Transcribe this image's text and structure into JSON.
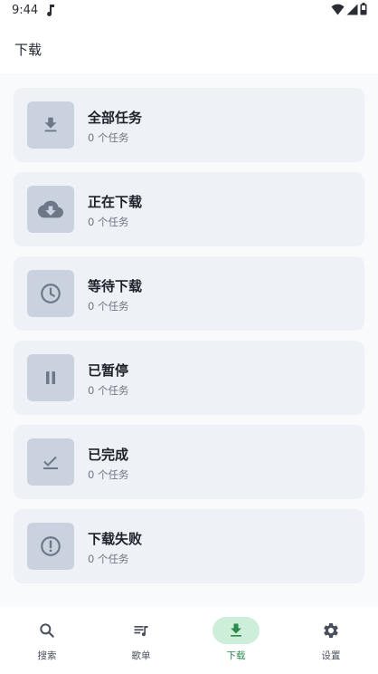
{
  "status_bar": {
    "time": "9:44"
  },
  "app_bar": {
    "title": "下载"
  },
  "categories": [
    {
      "title": "全部任务",
      "count_text": "0 个任务",
      "icon": "download-icon"
    },
    {
      "title": "正在下载",
      "count_text": "0 个任务",
      "icon": "cloud-download-icon"
    },
    {
      "title": "等待下载",
      "count_text": "0 个任务",
      "icon": "clock-icon"
    },
    {
      "title": "已暂停",
      "count_text": "0 个任务",
      "icon": "pause-icon"
    },
    {
      "title": "已完成",
      "count_text": "0 个任务",
      "icon": "done-icon"
    },
    {
      "title": "下载失败",
      "count_text": "0 个任务",
      "icon": "error-icon"
    }
  ],
  "bottom_nav": {
    "items": [
      {
        "label": "搜索",
        "icon": "search-icon",
        "active": false
      },
      {
        "label": "歌单",
        "icon": "playlist-icon",
        "active": false
      },
      {
        "label": "下载",
        "icon": "download-icon",
        "active": true
      },
      {
        "label": "设置",
        "icon": "settings-icon",
        "active": false
      }
    ]
  },
  "colors": {
    "accent": "#2c8a4f",
    "accent_pill": "#cdeed8",
    "card_bg": "#eef1f5",
    "icon_box_bg": "#c9d2de",
    "icon_fg": "#6d7788"
  }
}
